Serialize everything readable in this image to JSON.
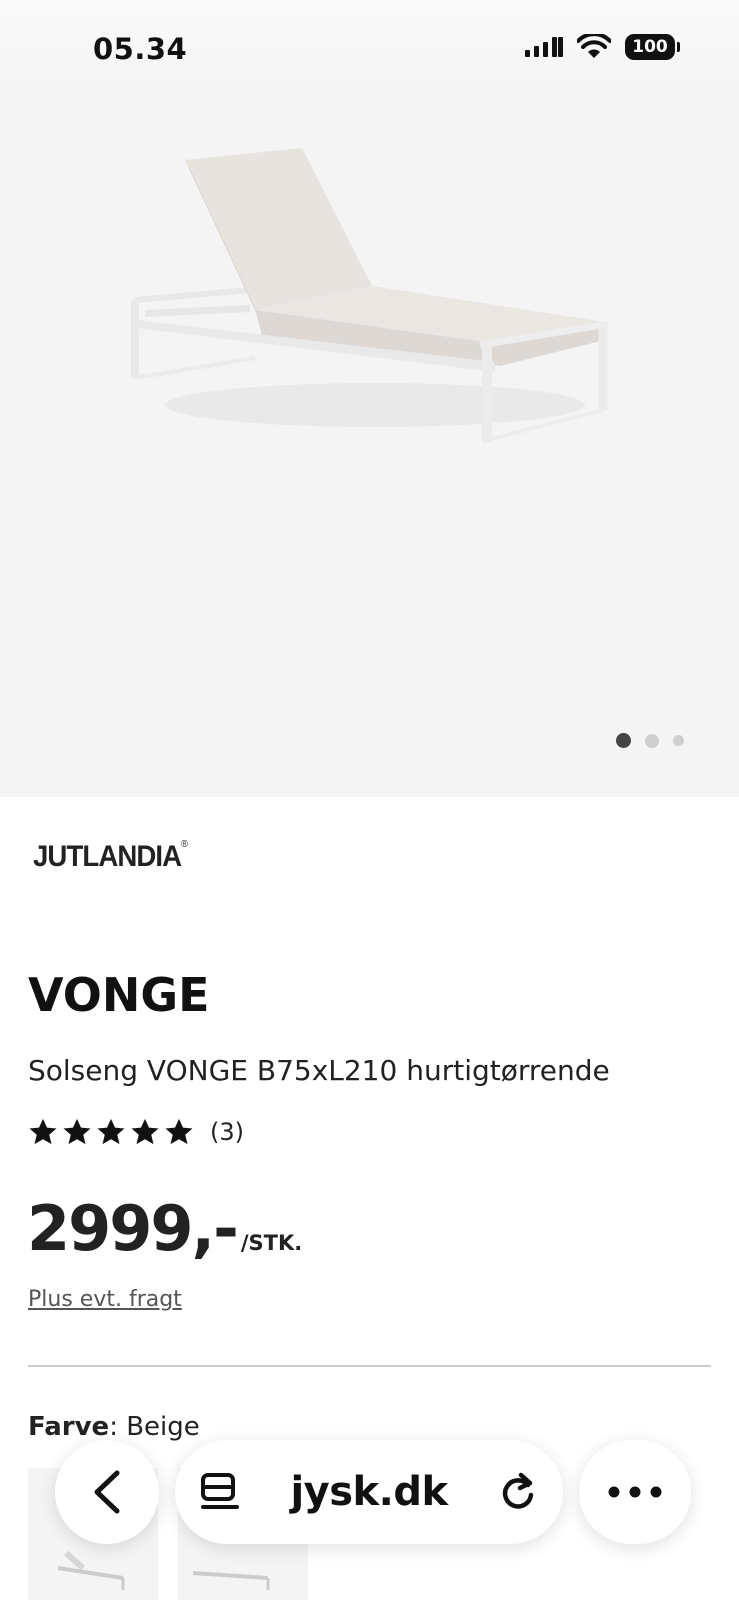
{
  "status_bar": {
    "time": "05.34",
    "battery": "100"
  },
  "hero": {
    "image_icon": "sun-lounger-image",
    "carousel_dots": 3,
    "active_dot": 1
  },
  "product": {
    "brand": "JUTLANDIA",
    "brand_mark": "®",
    "name": "VONGE",
    "description": "Solseng VONGE B75xL210 hurtigtørrende",
    "rating": 5,
    "review_count": "(3)",
    "price": "2999,-",
    "unit": "/STK.",
    "shipping_note": "Plus evt. fragt",
    "color_label": "Farve",
    "color_value": ": Beige"
  },
  "browser": {
    "url": "jysk.dk",
    "icons": [
      "chevron-left-icon",
      "tabs-icon",
      "reload-icon",
      "more-icon"
    ]
  },
  "colors": {
    "background": "#ffffff",
    "hero_bg": "#f4f4f4",
    "text": "#111111",
    "divider": "#cccccc"
  }
}
